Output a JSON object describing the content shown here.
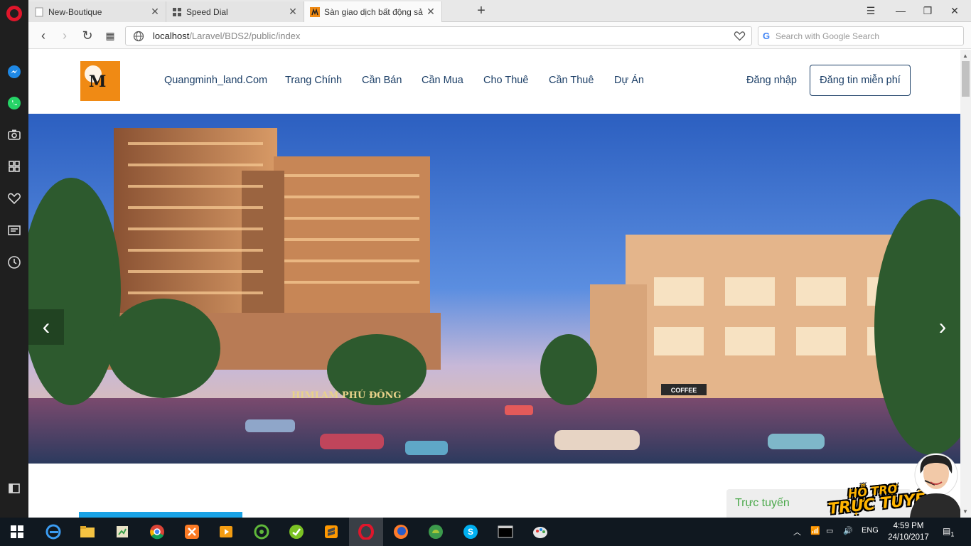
{
  "browser": {
    "tabs": [
      {
        "label": "New-Boutique"
      },
      {
        "label": "Speed Dial"
      },
      {
        "label": "Sàn giao dịch bất động sả"
      }
    ],
    "address": {
      "host": "localhost",
      "path": "/Laravel/BDS2/public/index"
    },
    "search_placeholder": "Search with Google Search"
  },
  "site": {
    "nav": [
      "Quangminh_land.Com",
      "Trang Chính",
      "Cần Bán",
      "Cần Mua",
      "Cho Thuê",
      "Cần Thuê",
      "Dự Án"
    ],
    "login": "Đăng nhập",
    "post_button": "Đăng tin miễn phí"
  },
  "hero": {
    "slide_text": "HIMLAM PHÚ ĐÔNG",
    "shop_sign": "COFFEE",
    "prev_arrow": "‹",
    "next_arrow": "›"
  },
  "support": {
    "status": "Trực tuyến",
    "banner_line1": "HỖ TRỢ",
    "banner_line2": "TRỰC TUYẾN"
  },
  "taskbar": {
    "lang": "ENG",
    "time": "4:59 PM",
    "date": "24/10/2017",
    "notifications": "1"
  },
  "colors": {
    "nav_text": "#1c3f67",
    "accent_orange": "#f08a14",
    "opera_red": "#e0162b",
    "support_green": "#4aa84a",
    "progress_blue": "#1aa3e6"
  }
}
